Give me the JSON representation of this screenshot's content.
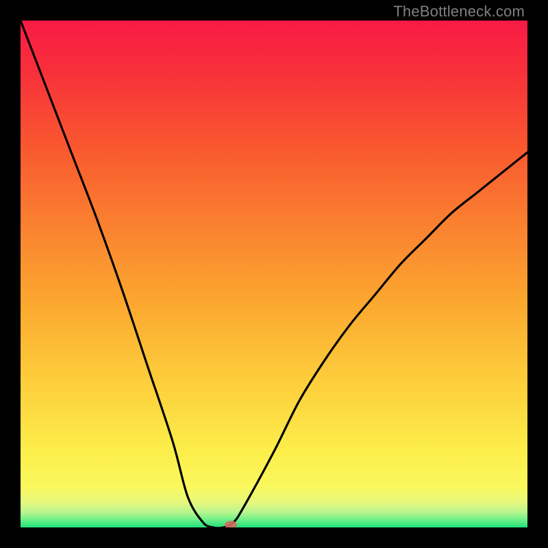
{
  "watermark": "TheBottleneck.com",
  "chart_data": {
    "type": "line",
    "title": "",
    "xlabel": "",
    "ylabel": "",
    "xlim": [
      0,
      100
    ],
    "ylim": [
      0,
      100
    ],
    "series": [
      {
        "name": "curve",
        "x": [
          0,
          5,
          10,
          15,
          20,
          25,
          30,
          33,
          36,
          38,
          40,
          42,
          44,
          50,
          55,
          60,
          65,
          70,
          75,
          80,
          85,
          90,
          95,
          100
        ],
        "y": [
          100,
          87,
          74,
          61,
          47,
          32,
          17,
          6,
          1,
          0,
          0,
          1,
          4,
          15,
          25,
          33,
          40,
          46,
          52,
          57,
          62,
          66,
          70,
          74
        ]
      }
    ],
    "marker": {
      "x": 41.5,
      "y": 0.5
    },
    "gradient_stops": [
      {
        "offset": 0.0,
        "color": "#1fe07a"
      },
      {
        "offset": 0.015,
        "color": "#6cf088"
      },
      {
        "offset": 0.03,
        "color": "#b8f58e"
      },
      {
        "offset": 0.05,
        "color": "#e7f87c"
      },
      {
        "offset": 0.08,
        "color": "#faf85e"
      },
      {
        "offset": 0.15,
        "color": "#fcee4a"
      },
      {
        "offset": 0.3,
        "color": "#fdcb3a"
      },
      {
        "offset": 0.45,
        "color": "#fba62f"
      },
      {
        "offset": 0.6,
        "color": "#fa8030"
      },
      {
        "offset": 0.75,
        "color": "#f9582f"
      },
      {
        "offset": 0.9,
        "color": "#f8303a"
      },
      {
        "offset": 1.0,
        "color": "#f81a45"
      }
    ]
  }
}
